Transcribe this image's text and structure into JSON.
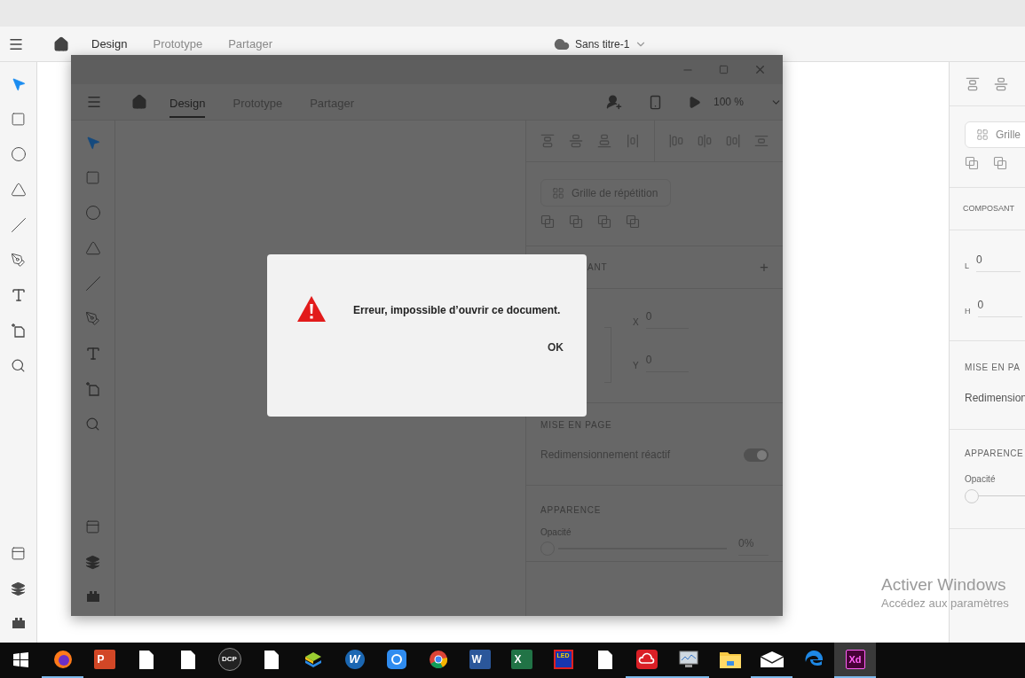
{
  "app": {
    "header": {
      "tabs": [
        {
          "label": "Design",
          "selected": true
        },
        {
          "label": "Prototype",
          "selected": false
        },
        {
          "label": "Partager",
          "selected": false
        }
      ],
      "document_title": "Sans titre-1"
    },
    "tools": [
      {
        "kind": "select",
        "selected": true
      },
      {
        "kind": "rectangle",
        "selected": false
      },
      {
        "kind": "ellipse",
        "selected": false
      },
      {
        "kind": "polygon",
        "selected": false
      },
      {
        "kind": "line",
        "selected": false
      },
      {
        "kind": "pen",
        "selected": false
      },
      {
        "kind": "text",
        "selected": false
      },
      {
        "kind": "artboard",
        "selected": false
      },
      {
        "kind": "zoom",
        "selected": false
      }
    ],
    "bottom_tools": [
      {
        "kind": "assets"
      },
      {
        "kind": "layers"
      },
      {
        "kind": "plugins"
      }
    ],
    "right_panel": {
      "repeat_grid": "Grille",
      "component_heading": "COMPOSANT",
      "width_label": "L",
      "width_value": "0",
      "height_label": "H",
      "height_value": "0",
      "layout_heading": "MISE EN PA",
      "layout_item": "Redimension",
      "appearance_heading": "APPARENCE",
      "opacity_label": "Opacité",
      "opacity": {
        "level": 0
      }
    }
  },
  "window": {
    "header": {
      "tabs": [
        {
          "label": "Design",
          "selected": true
        },
        {
          "label": "Prototype",
          "selected": false
        },
        {
          "label": "Partager",
          "selected": false
        }
      ],
      "zoom": "100 %"
    },
    "tools": [
      {
        "kind": "select",
        "selected": true
      },
      {
        "kind": "rectangle",
        "selected": false
      },
      {
        "kind": "ellipse",
        "selected": false
      },
      {
        "kind": "polygon",
        "selected": false
      },
      {
        "kind": "line",
        "selected": false
      },
      {
        "kind": "pen",
        "selected": false
      },
      {
        "kind": "text",
        "selected": false
      },
      {
        "kind": "artboard",
        "selected": false
      },
      {
        "kind": "zoom",
        "selected": false
      }
    ],
    "bottom_tools": [
      {
        "kind": "assets"
      },
      {
        "kind": "layers"
      },
      {
        "kind": "plugins"
      }
    ],
    "right_panel": {
      "repeat_grid": "Grille de répétition",
      "component_heading": "ANT",
      "add": "+",
      "x_label": "X",
      "x_value": "0",
      "y_label": "Y",
      "y_value": "0",
      "layout_heading": "MISE EN PAGE",
      "responsive_resize": {
        "label": "Redimensionnement réactif",
        "on": true
      },
      "appearance_heading": "APPARENCE",
      "opacity_label": "Opacité",
      "opacity": {
        "level": 0,
        "reading": "0%"
      }
    }
  },
  "dialog": {
    "message": "Erreur, impossible d’ouvrir ce document.",
    "button": "OK"
  },
  "watermark_notice": {
    "title": "Activer Windows",
    "subtitle": "Accédez aux paramètres"
  },
  "taskbar": [
    {
      "kind": "start",
      "running": false,
      "selected": false
    },
    {
      "kind": "firefox",
      "running": true,
      "selected": false
    },
    {
      "kind": "powerpoint",
      "label": "P",
      "running": false,
      "selected": false
    },
    {
      "kind": "file",
      "running": false,
      "selected": false
    },
    {
      "kind": "file",
      "running": false,
      "selected": false
    },
    {
      "kind": "dcp",
      "label": "DCP",
      "running": false,
      "selected": false
    },
    {
      "kind": "file",
      "running": false,
      "selected": false
    },
    {
      "kind": "stack",
      "running": false,
      "selected": false
    },
    {
      "kind": "w-app",
      "label": "W",
      "running": false,
      "selected": false
    },
    {
      "kind": "sync",
      "running": false,
      "selected": false
    },
    {
      "kind": "chrome",
      "running": false,
      "selected": false
    },
    {
      "kind": "word",
      "label": "W",
      "running": false,
      "selected": false
    },
    {
      "kind": "excel",
      "label": "X",
      "running": false,
      "selected": false
    },
    {
      "kind": "led",
      "label": "LED",
      "running": false,
      "selected": false
    },
    {
      "kind": "file",
      "running": false,
      "selected": false
    },
    {
      "kind": "cloud-app",
      "running": true,
      "selected": false
    },
    {
      "kind": "monitor",
      "running": true,
      "selected": false
    },
    {
      "kind": "folder",
      "running": false,
      "selected": false
    },
    {
      "kind": "mail",
      "running": true,
      "selected": false
    },
    {
      "kind": "edge",
      "running": false,
      "selected": false
    },
    {
      "kind": "xd",
      "label": "Xd",
      "running": true,
      "selected": true
    }
  ]
}
